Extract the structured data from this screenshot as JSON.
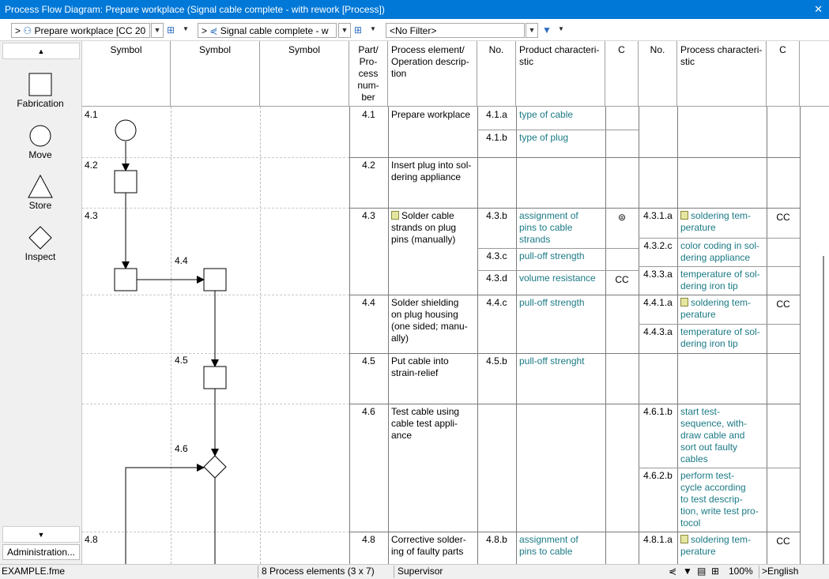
{
  "window": {
    "title": "Process Flow Diagram: Prepare workplace (Signal cable complete - with rework [Process])",
    "close": "✕"
  },
  "toolbar": {
    "nav1_prefix": ">",
    "combo1": "Prepare workplace [CC 20",
    "nav2_prefix": ">",
    "combo2": "Signal cable complete - w",
    "filter": "<No Filter>"
  },
  "palette": {
    "items": [
      "Fabrication",
      "Move",
      "Store",
      "Inspect"
    ],
    "admin": "Administration..."
  },
  "columns": [
    "Symbol",
    "Symbol",
    "Symbol",
    "Part/\nPro-\ncess\nnum-\nber",
    "Process element/\nOperation descrip-\ntion",
    "No.",
    "Product characteri-\nstic",
    "C",
    "No.",
    "Process characteri-\nstic",
    "C"
  ],
  "rows": [
    {
      "sym1": "4.1",
      "num": "4.1",
      "desc": "Prepare workplace",
      "products": [
        {
          "no": "4.1.a",
          "name": "type of cable",
          "c": ""
        },
        {
          "no": "4.1.b",
          "name": "type of plug",
          "c": ""
        }
      ],
      "processes": []
    },
    {
      "sym1": "4.2",
      "num": "4.2",
      "desc": "Insert plug into sol-\ndering appliance",
      "products": [],
      "processes": []
    },
    {
      "sym1": "4.3",
      "sym2": "4.4",
      "num": "4.3",
      "desc": "Solder cable\nstrands on plug\npins (manually)",
      "products": [
        {
          "no": "4.3.b",
          "name": "assignment of\npins to cable\nstrands",
          "c": "⊜"
        },
        {
          "no": "4.3.c",
          "name": "pull-off strength",
          "c": ""
        },
        {
          "no": "4.3.d",
          "name": "volume resistance",
          "c": "CC"
        }
      ],
      "processes": [
        {
          "no": "4.3.1.a",
          "name": "soldering tem-\nperature",
          "c": "CC"
        },
        {
          "no": "4.3.2.c",
          "name": "color coding in sol-\ndering appliance",
          "c": ""
        },
        {
          "no": "4.3.3.a",
          "name": "temperature of sol-\ndering iron tip",
          "c": ""
        }
      ]
    },
    {
      "num": "4.4",
      "desc": "Solder shielding\non plug housing\n(one sided; manu-\nally)",
      "products": [
        {
          "no": "4.4.c",
          "name": "pull-off strength",
          "c": ""
        }
      ],
      "processes": [
        {
          "no": "4.4.1.a",
          "name": "soldering tem-\nperature",
          "c": "CC"
        },
        {
          "no": "4.4.3.a",
          "name": "temperature of sol-\ndering iron tip",
          "c": ""
        }
      ]
    },
    {
      "sym2": "4.5",
      "num": "4.5",
      "desc": "Put cable into\nstrain-relief",
      "products": [
        {
          "no": "4.5.b",
          "name": "pull-off strenght",
          "c": ""
        }
      ],
      "processes": []
    },
    {
      "sym2": "4.6",
      "num": "4.6",
      "desc": "Test cable using\ncable test appli-\nance",
      "products": [],
      "processes": [
        {
          "no": "4.6.1.b",
          "name": "start test-\nsequence, with-\ndraw cable and\nsort out faulty\ncables",
          "c": ""
        },
        {
          "no": "4.6.2.b",
          "name": "perform test-\ncycle according\nto test descrip-\ntion, write test pro-\ntocol",
          "c": ""
        }
      ]
    },
    {
      "sym1": "4.8",
      "num": "4.8",
      "desc": "Corrective solder-\ning of faulty parts",
      "products": [
        {
          "no": "4.8.b",
          "name": "assignment of\npins to cable",
          "c": ""
        }
      ],
      "processes": [
        {
          "no": "4.8.1.a",
          "name": "soldering tem-\nperature",
          "c": "CC"
        }
      ]
    }
  ],
  "status": {
    "file": "EXAMPLE.fme",
    "elements": "8 Process elements (3 x 7)",
    "role": "Supervisor",
    "zoom": "100%",
    "language": ">English"
  }
}
